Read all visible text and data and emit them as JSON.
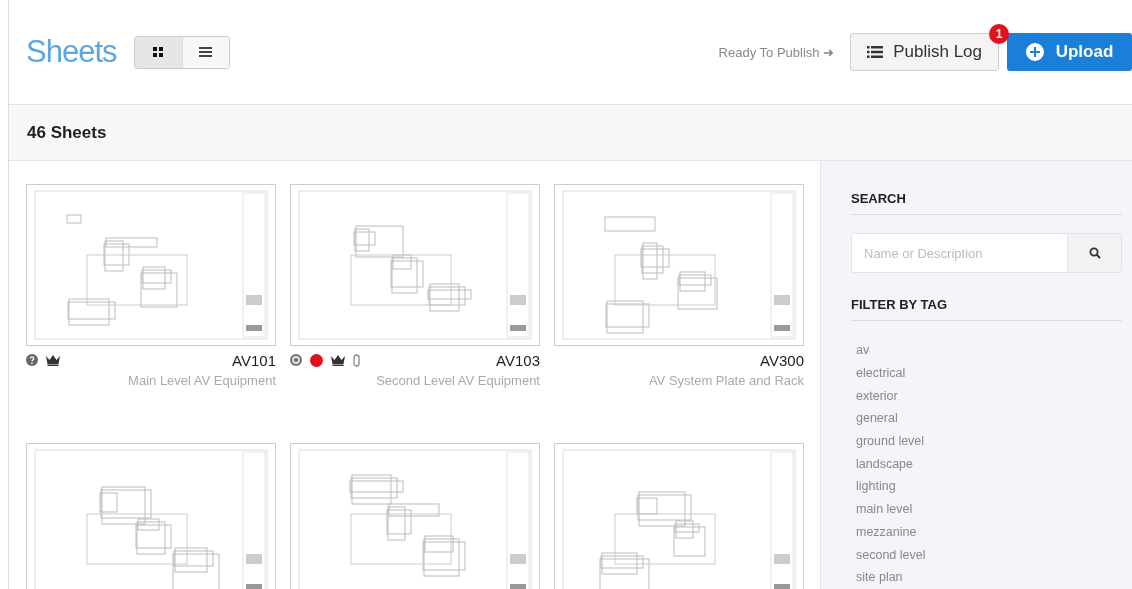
{
  "header": {
    "title": "Sheets",
    "view_toggle": [
      {
        "kind": "grid",
        "selected": true
      },
      {
        "kind": "list",
        "selected": false
      }
    ],
    "ready_link": "Ready To Publish ➜",
    "publish_log": {
      "label": "Publish Log",
      "badge": "1"
    },
    "upload": {
      "label": "Upload"
    }
  },
  "count_bar": {
    "label": "46 Sheets"
  },
  "sheets": [
    {
      "kind": "labeled",
      "number": "AV101",
      "description": "Main Level AV Equipment",
      "icons": [
        {
          "kind": "help"
        },
        {
          "kind": "crown"
        }
      ]
    },
    {
      "kind": "labeled",
      "number": "AV103",
      "description": "Second Level AV Equipment",
      "icons": [
        {
          "kind": "badge"
        },
        {
          "kind": "dot",
          "color": "#e0131a"
        },
        {
          "kind": "crown"
        },
        {
          "kind": "clip"
        }
      ]
    },
    {
      "kind": "labeled",
      "number": "AV300",
      "description": "AV System Plate and Rack"
    },
    {
      "kind": "thumbnail"
    },
    {
      "kind": "thumbnail"
    },
    {
      "kind": "thumbnail"
    }
  ],
  "sidebar": {
    "search_heading": "SEARCH",
    "search": {
      "placeholder": "Name or Description"
    },
    "filter_heading": "FILTER BY TAG",
    "tags": [
      "av",
      "electrical",
      "exterior",
      "general",
      "ground level",
      "landscape",
      "lighting",
      "main level",
      "mezzanine",
      "second level",
      "site plan"
    ]
  }
}
